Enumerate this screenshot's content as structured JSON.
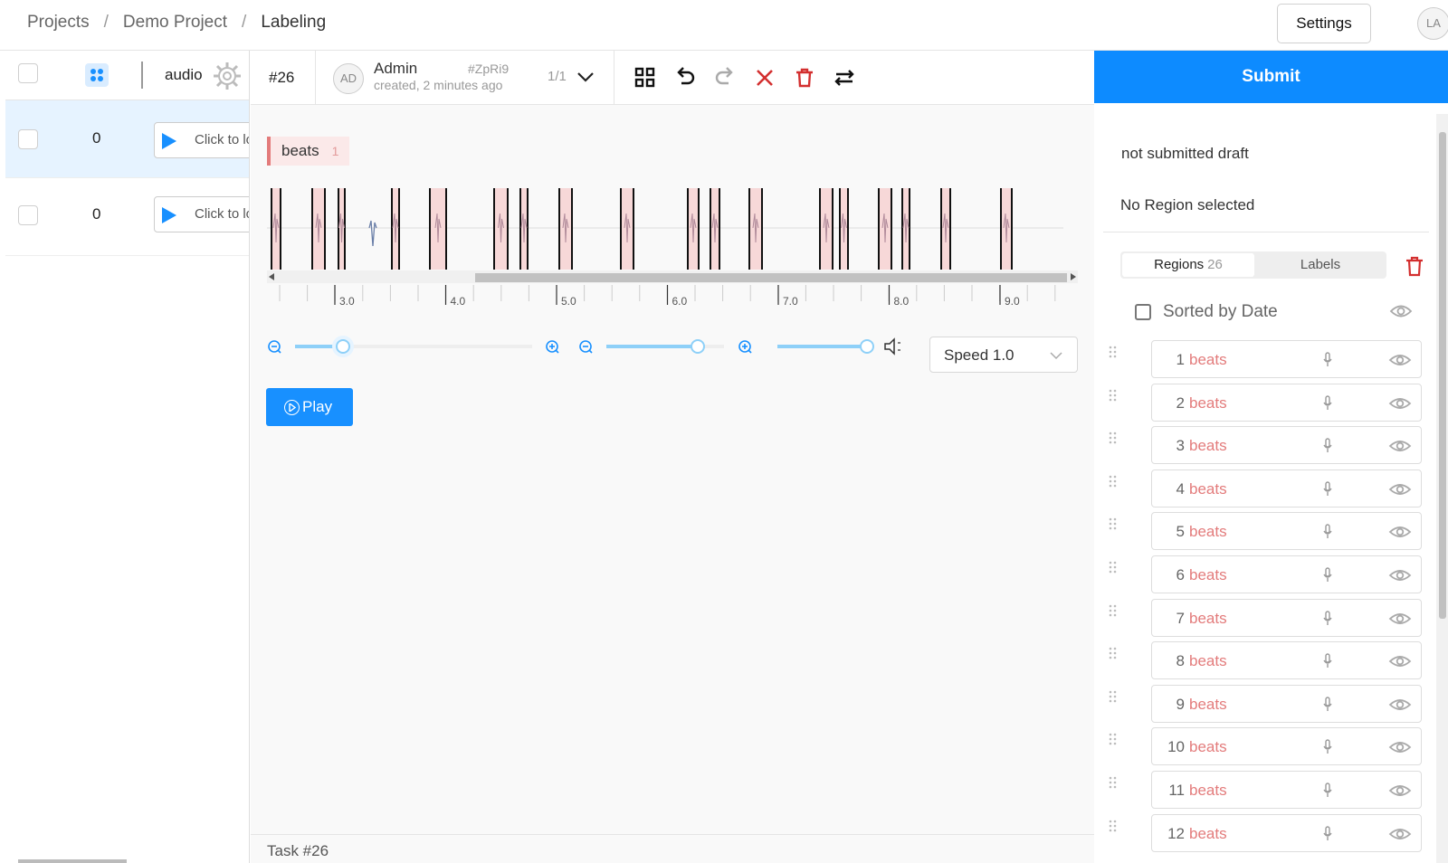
{
  "breadcrumb": {
    "projects": "Projects",
    "project": "Demo Project",
    "current": "Labeling"
  },
  "header": {
    "settings_label": "Settings",
    "user_initials": "LA"
  },
  "datamanager": {
    "column_label": "audio",
    "rows": [
      {
        "value": "0",
        "player_text": "Click to load",
        "selected": true
      },
      {
        "value": "0",
        "player_text": "Click to load",
        "selected": false
      }
    ]
  },
  "task": {
    "id": "#26",
    "annotator_initials": "AD",
    "annotator_name": "Admin",
    "annotation_hash": "#ZpRi9",
    "created": "created, 2 minutes ago",
    "annotation_count": "1/1",
    "footer": "Task #26"
  },
  "labels": [
    {
      "name": "beats",
      "hotkey": "1",
      "color": "#e37b7b"
    }
  ],
  "audio": {
    "timeline_ticks": [
      "3.0",
      "4.0",
      "5.0",
      "6.0",
      "7.0",
      "8.0",
      "9.0"
    ],
    "speed_label": "Speed 1.0",
    "play_label": "Play",
    "zoom_level": 0.2,
    "waveform_zoom": 0.78,
    "volume": 1.0
  },
  "sidebar": {
    "submit_label": "Submit",
    "draft_status": "not submitted draft",
    "region_status": "No Region selected",
    "tabs": {
      "regions_label": "Regions",
      "regions_count": "26",
      "labels_label": "Labels"
    },
    "sort_label": "Sorted by Date",
    "regions": [
      {
        "num": "1",
        "label": "beats"
      },
      {
        "num": "2",
        "label": "beats"
      },
      {
        "num": "3",
        "label": "beats"
      },
      {
        "num": "4",
        "label": "beats"
      },
      {
        "num": "5",
        "label": "beats"
      },
      {
        "num": "6",
        "label": "beats"
      },
      {
        "num": "7",
        "label": "beats"
      },
      {
        "num": "8",
        "label": "beats"
      },
      {
        "num": "9",
        "label": "beats"
      },
      {
        "num": "10",
        "label": "beats"
      },
      {
        "num": "11",
        "label": "beats"
      },
      {
        "num": "12",
        "label": "beats"
      }
    ]
  },
  "colors": {
    "accent": "#1890ff",
    "submit": "#0d8bff",
    "region": "#e37b7b",
    "danger": "#d32f2f"
  }
}
